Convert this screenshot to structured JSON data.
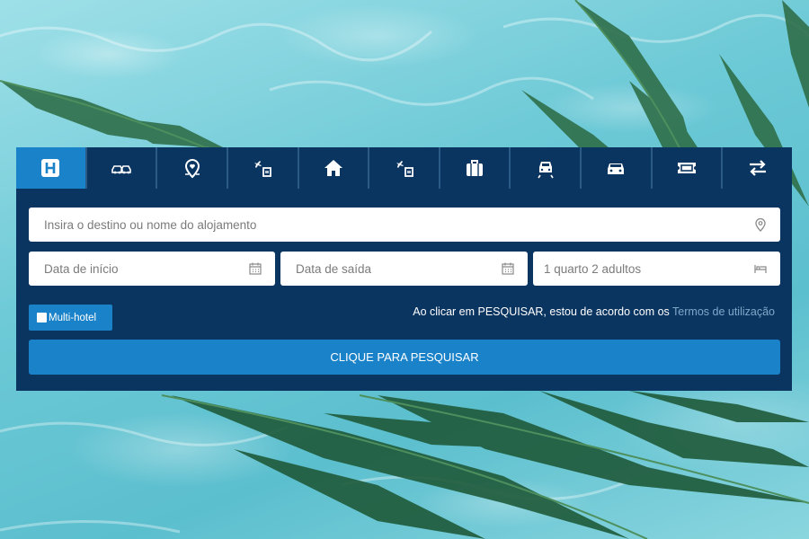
{
  "tabs": [
    {
      "icon": "hotel-icon",
      "active": true
    },
    {
      "icon": "car-hire-icon",
      "active": false
    },
    {
      "icon": "location-heart-icon",
      "active": false
    },
    {
      "icon": "flight-hotel-icon",
      "active": false
    },
    {
      "icon": "home-icon",
      "active": false
    },
    {
      "icon": "flight-hotel-icon",
      "active": false
    },
    {
      "icon": "suitcase-icon",
      "active": false
    },
    {
      "icon": "transfer-car-icon",
      "active": false
    },
    {
      "icon": "car-icon",
      "active": false
    },
    {
      "icon": "ticket-icon",
      "active": false
    },
    {
      "icon": "swap-arrows-icon",
      "active": false
    }
  ],
  "search": {
    "destination_placeholder": "Insira o destino ou nome do alojamento",
    "start_placeholder": "Data de início",
    "end_placeholder": "Data de saída",
    "rooms_value": "1 quarto 2 adultos"
  },
  "multi_hotel": {
    "label": "Multi-hotel"
  },
  "terms": {
    "text": "Ao clicar em PESQUISAR, estou de acordo com os ",
    "link": "Termos de utilização"
  },
  "search_button": {
    "label": "CLIQUE PARA PESQUISAR"
  },
  "colors": {
    "panel": "#0b3561",
    "accent": "#1a82c9"
  }
}
